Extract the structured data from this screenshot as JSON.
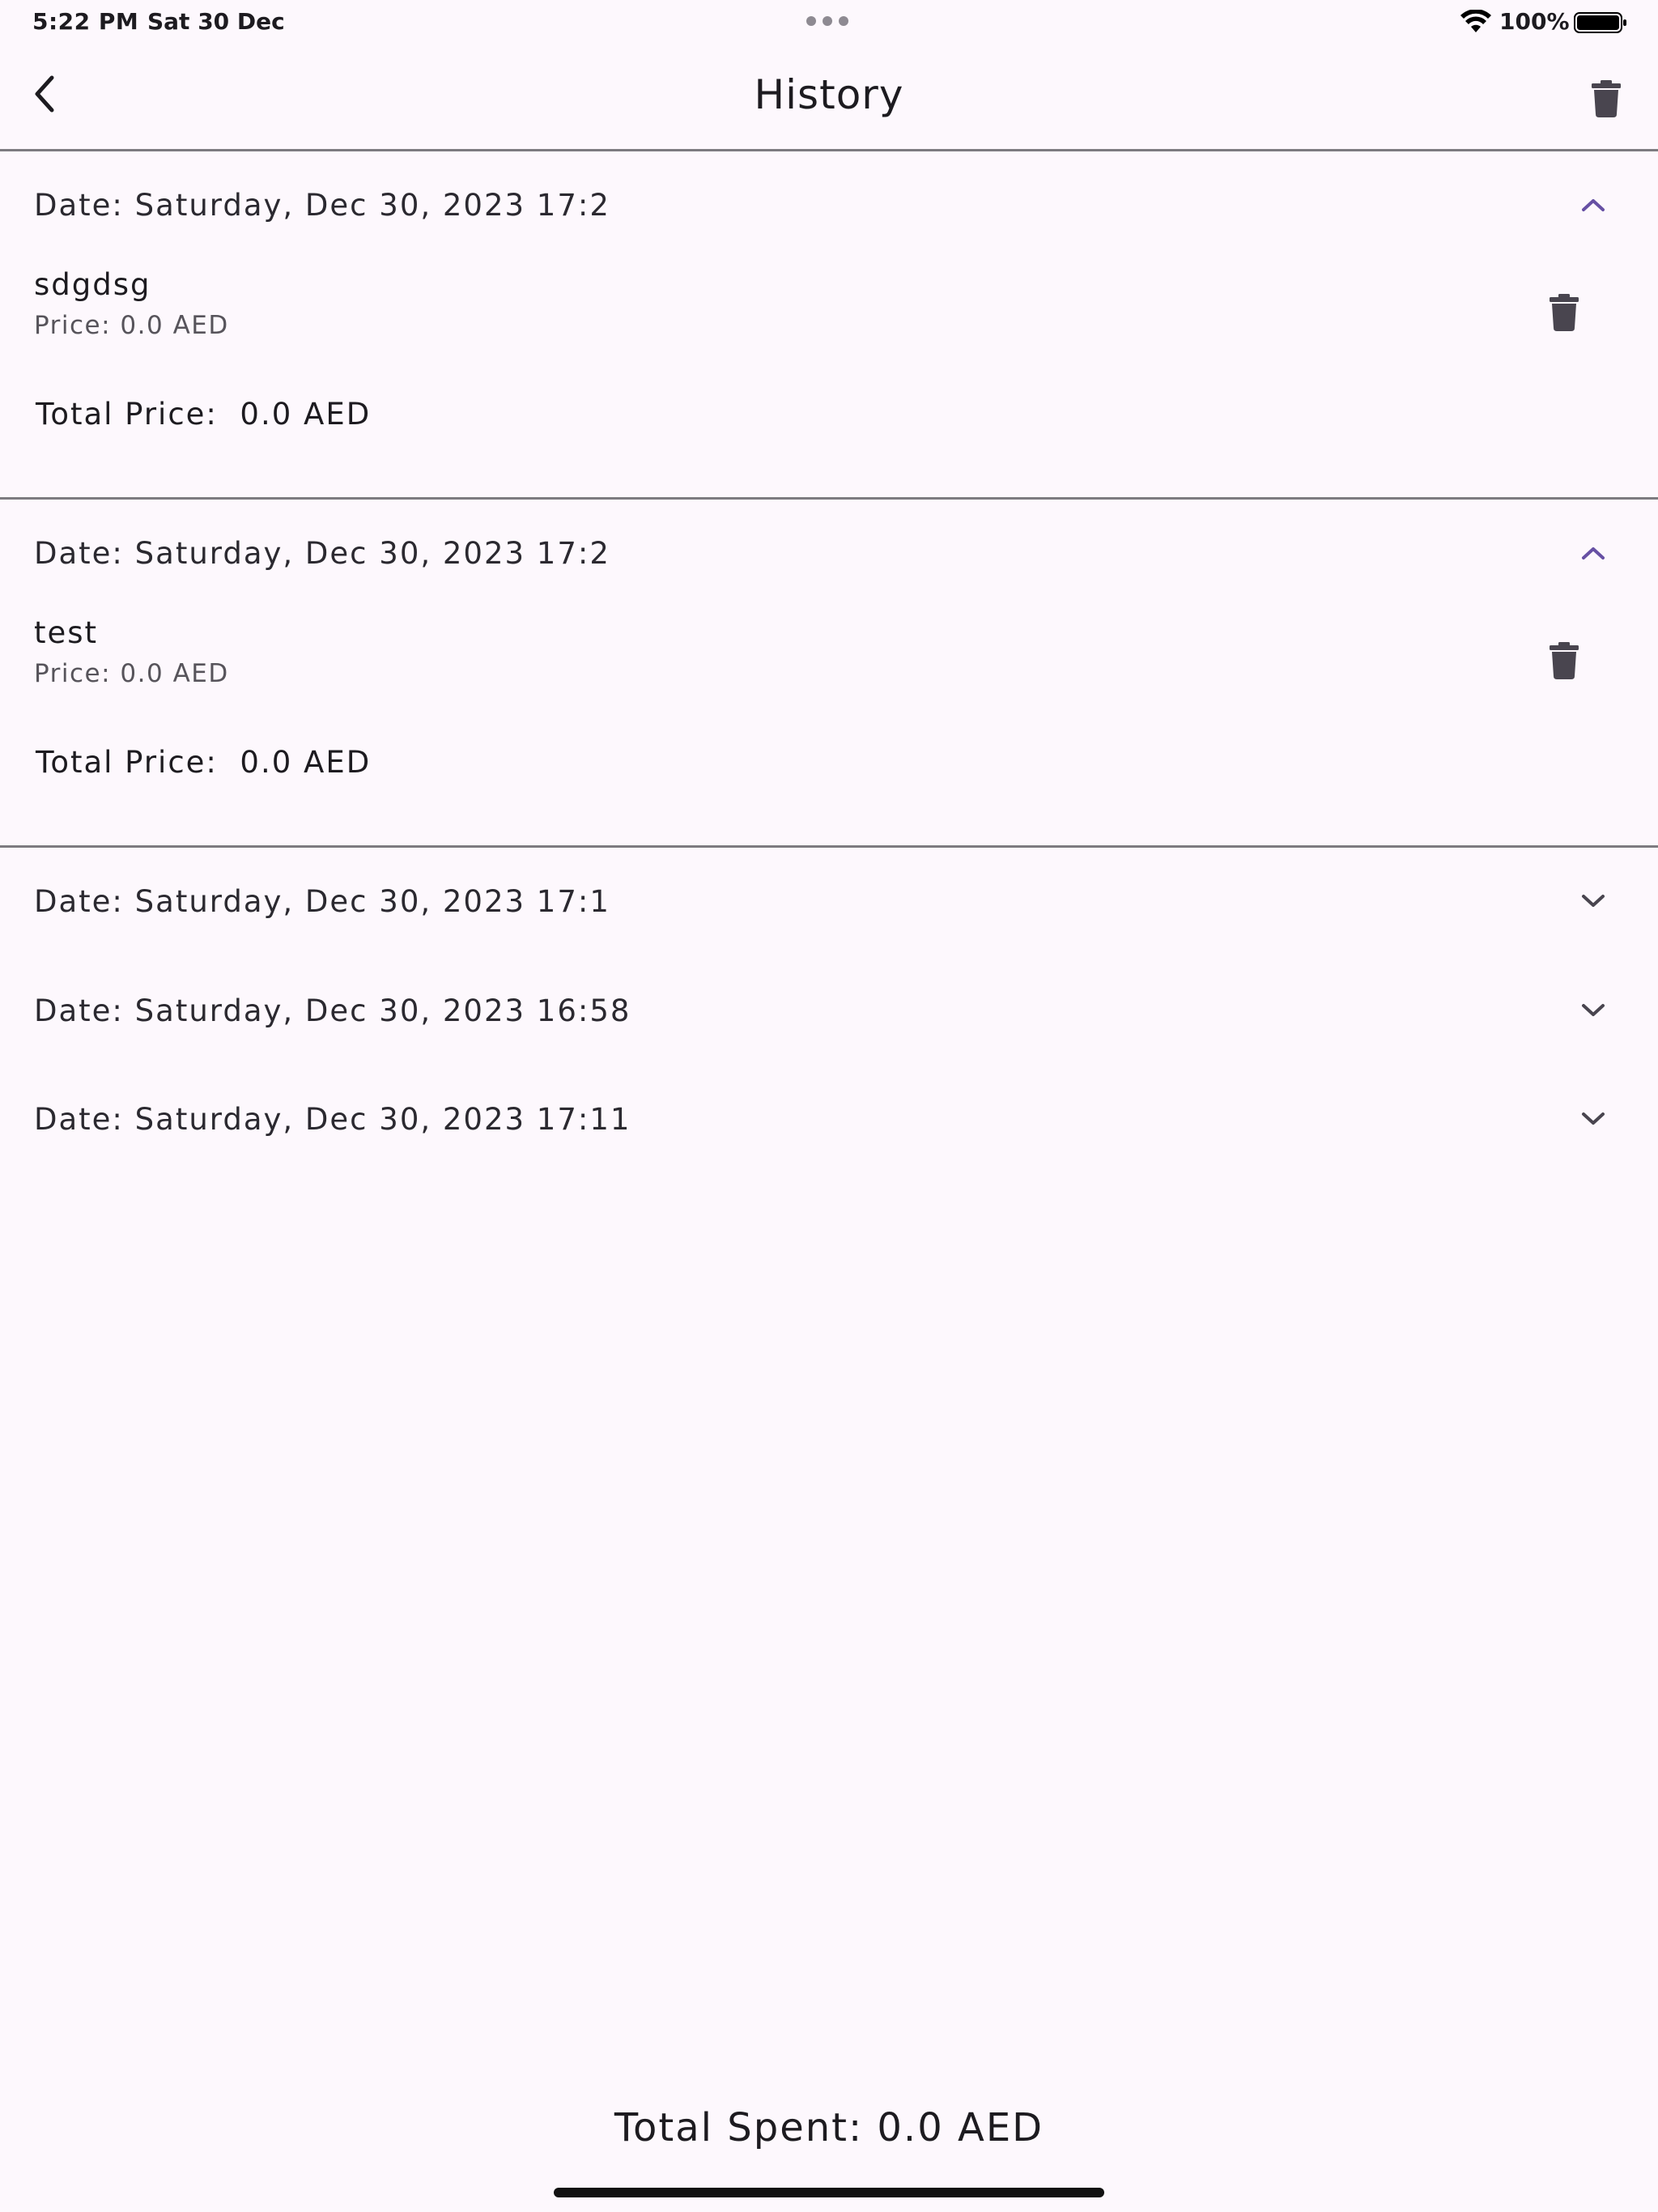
{
  "status_bar": {
    "time": "5:22 PM",
    "date": "Sat 30 Dec",
    "battery": "100%",
    "icons": [
      "wifi-icon",
      "battery-icon",
      "more-dots-icon"
    ]
  },
  "app_bar": {
    "title": "History",
    "icons": [
      "back-chevron-icon",
      "trash-icon"
    ]
  },
  "sections": [
    {
      "date": "Date: Saturday, Dec 30, 2023 17:2",
      "expanded": true,
      "items": [
        {
          "name": "sdgdsg",
          "price": "Price:  0.0 AED"
        }
      ],
      "total": "Total Price:  0.0 AED"
    },
    {
      "date": "Date: Saturday, Dec 30, 2023 17:2",
      "expanded": true,
      "items": [
        {
          "name": "test",
          "price": "Price:  0.0 AED"
        }
      ],
      "total": "Total Price:  0.0 AED"
    },
    {
      "date": "Date: Saturday, Dec 30, 2023 17:1",
      "expanded": false
    },
    {
      "date": "Date: Saturday, Dec 30, 2023 16:58",
      "expanded": false
    },
    {
      "date": "Date: Saturday, Dec 30, 2023 17:11",
      "expanded": false
    }
  ],
  "footer": {
    "total_spent": "Total Spent: 0.0 AED"
  },
  "colors": {
    "background": "#fdf8fd",
    "accent": "#6750a4",
    "icon": "#49454f",
    "divider": "#7d7b80"
  }
}
